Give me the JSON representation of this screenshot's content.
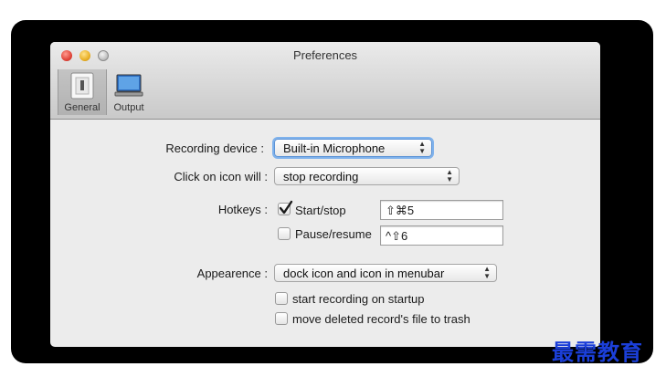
{
  "window": {
    "title": "Preferences"
  },
  "toolbar": {
    "items": [
      {
        "label": "General",
        "icon": "general-prefs-icon",
        "selected": true
      },
      {
        "label": "Output",
        "icon": "monitor-icon",
        "selected": false
      }
    ]
  },
  "form": {
    "recording_device": {
      "label": "Recording device :",
      "value": "Built-in Microphone"
    },
    "click_on_icon": {
      "label": "Click on icon will :",
      "value": "stop recording"
    },
    "hotkeys": {
      "label": "Hotkeys :",
      "start_stop": {
        "label": "Start/stop",
        "checked": true,
        "shortcut": "⇧⌘5"
      },
      "pause_resume": {
        "label": "Pause/resume",
        "checked": false,
        "shortcut": "^⇧6"
      }
    },
    "appearance": {
      "label": "Appearence :",
      "value": "dock icon and icon in menubar"
    },
    "start_on_startup": {
      "label": "start recording on startup",
      "checked": false
    },
    "move_to_trash": {
      "label": "move deleted record's file to trash",
      "checked": false
    }
  },
  "watermark": "最需教育",
  "colors": {
    "focus_ring": "#7fb2ec",
    "watermark": "#1b3fd9",
    "window_bg": "#ececec"
  }
}
